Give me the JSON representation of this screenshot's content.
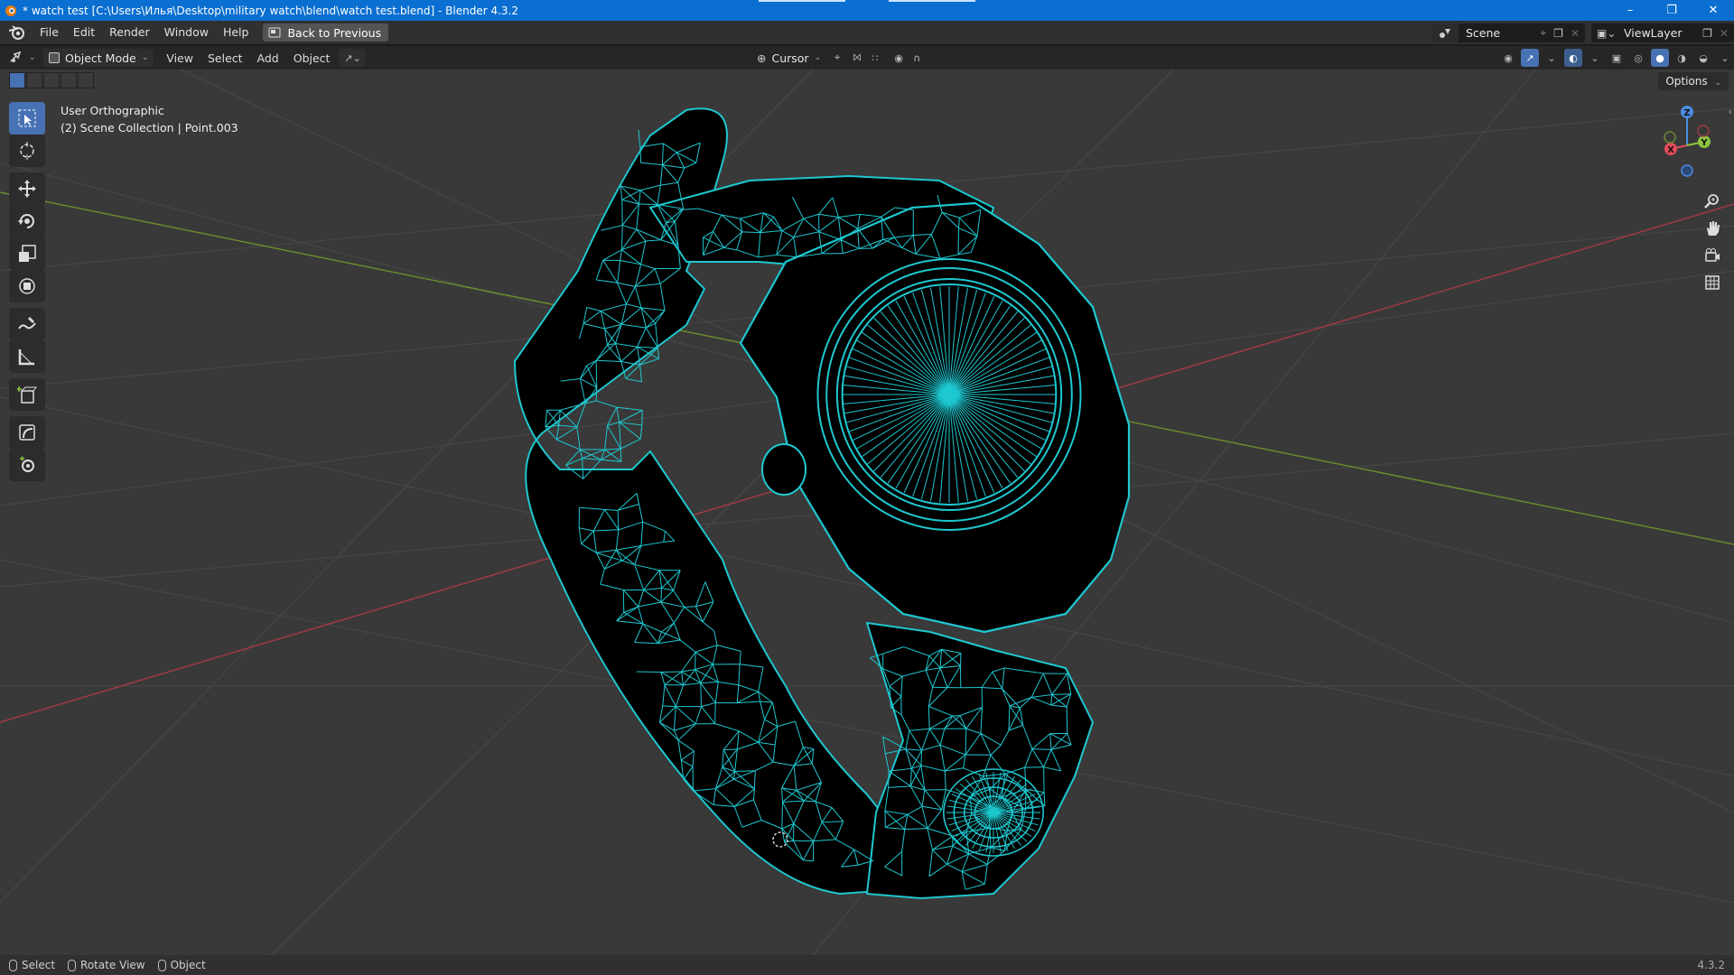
{
  "window": {
    "title": "* watch test [C:\\Users\\Илья\\Desktop\\military watch\\blend\\watch test.blend] - Blender 4.3.2",
    "controls": [
      "minimize-icon",
      "restore-icon",
      "close-icon"
    ]
  },
  "topbar": {
    "menus": [
      "File",
      "Edit",
      "Render",
      "Window",
      "Help"
    ],
    "back_button": "Back to Previous",
    "scene_name": "Scene",
    "view_layer": "ViewLayer"
  },
  "viewport_header": {
    "mode": "Object Mode",
    "menus": [
      "View",
      "Select",
      "Add",
      "Object"
    ],
    "pivot": "Cursor",
    "options_label": "Options"
  },
  "viewport": {
    "view_name": "User Orthographic",
    "collection_info": "(2) Scene Collection | Point.003",
    "wire_color": "#1ec8d0",
    "grid_color": "#474747",
    "x_axis_color": "#9e3a44",
    "y_axis_color": "#6a8a2e"
  },
  "gizmo": {
    "x": "X",
    "y": "Y",
    "z": "Z",
    "x_color": "#e24b5b",
    "y_color": "#8bc43f",
    "z_color": "#4b8be2"
  },
  "toolbar": {
    "tools": [
      "select-box-icon",
      "cursor-icon",
      "move-icon",
      "rotate-icon",
      "scale-icon",
      "transform-icon",
      "annotate-icon",
      "measure-icon",
      "add-cube-icon",
      "shear-icon",
      "spin-icon"
    ]
  },
  "statusbar": {
    "items": [
      "Select",
      "Rotate View",
      "Object"
    ],
    "version": "4.3.2"
  }
}
